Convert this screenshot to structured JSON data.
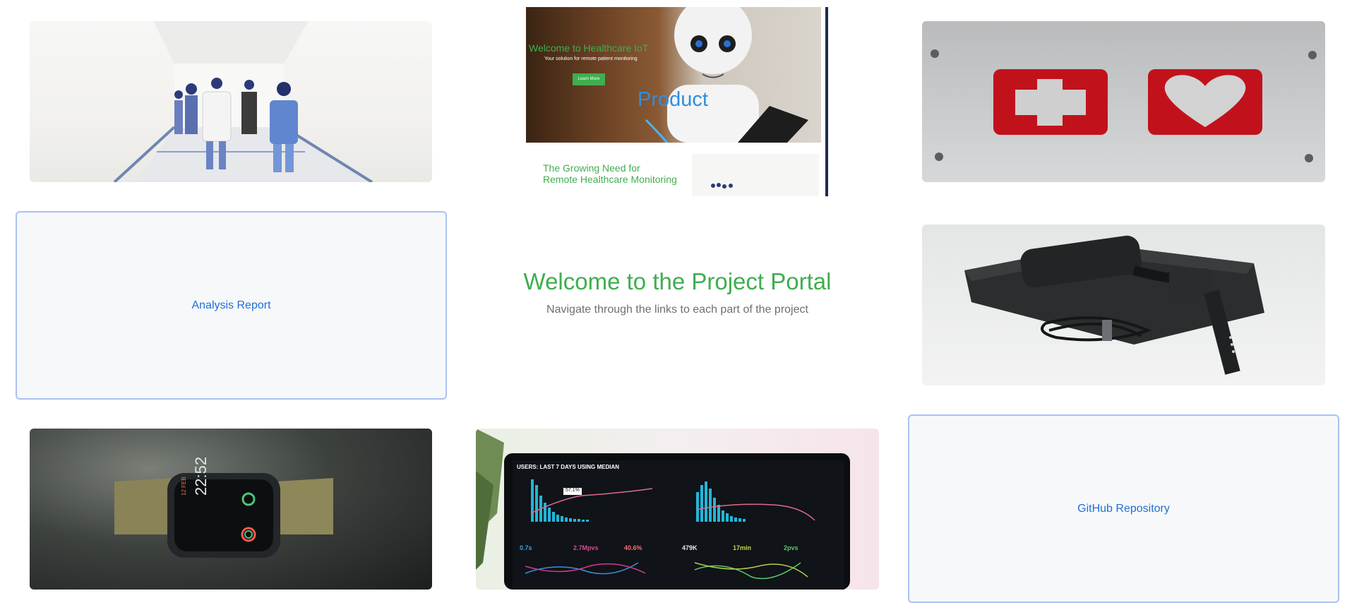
{
  "header": {
    "title": "Welcome to the Project Portal",
    "subtitle": "Navigate through the links to each part of the project"
  },
  "links": {
    "analysis": "Analysis Report",
    "github": "GitHub Repository"
  },
  "preview": {
    "hero_title": "Welcome to Healthcare IoT",
    "hero_subtitle": "Your solution for remote patient monitoring",
    "button_label": "Learn More",
    "overlay_label": "Product",
    "section_heading": "The Growing Need for Remote Healthcare Monitoring"
  },
  "watch_face": {
    "time": "22:52",
    "date": "12 FEB"
  },
  "dashboard": {
    "title": "USERS: LAST 7 DAYS USING MEDIAN",
    "callout": "57.1%",
    "metrics": [
      "0.7s",
      "2.7Mpvs",
      "40.6%",
      "479K",
      "17min",
      "2pvs"
    ]
  },
  "colors": {
    "accent_green": "#3fae4f",
    "link_blue": "#1f6fd6",
    "card_border": "#a9c2f2"
  }
}
